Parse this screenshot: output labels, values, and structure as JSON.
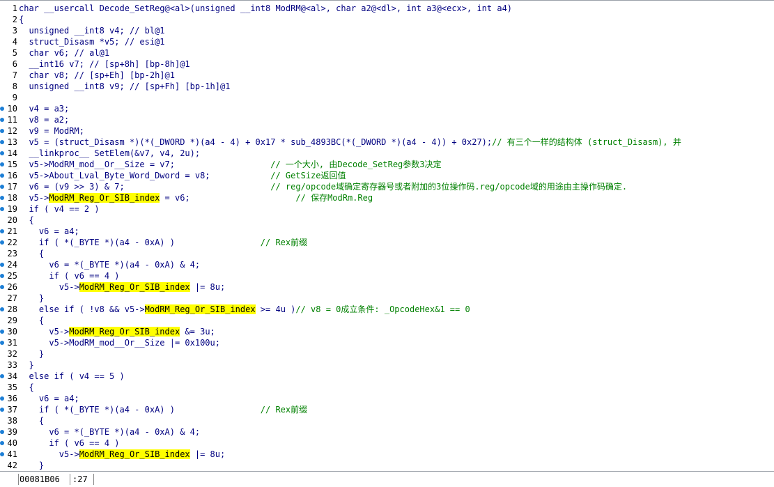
{
  "colors": {
    "default": "#000080",
    "comment": "#008000",
    "highlight_bg": "#ffff00",
    "breakpoint": "#1d7fd6"
  },
  "lines": [
    {
      "n": "1",
      "bp": false,
      "segs": [
        [
          "char __usercall Decode_SetReg@<al>(unsigned __int8 ModRM@<al>, char a2@<dl>, int a3@<ecx>, int a4)",
          "p"
        ]
      ]
    },
    {
      "n": "2",
      "bp": false,
      "segs": [
        [
          "{",
          "p"
        ]
      ]
    },
    {
      "n": "3",
      "bp": false,
      "segs": [
        [
          "  unsigned __int8 v4; ",
          "p"
        ],
        [
          "// bl@1",
          "v"
        ]
      ]
    },
    {
      "n": "4",
      "bp": false,
      "segs": [
        [
          "  struct_Disasm *v5; ",
          "p"
        ],
        [
          "// esi@1",
          "v"
        ]
      ]
    },
    {
      "n": "5",
      "bp": false,
      "segs": [
        [
          "  char v6; ",
          "p"
        ],
        [
          "// al@1",
          "v"
        ]
      ]
    },
    {
      "n": "6",
      "bp": false,
      "segs": [
        [
          "  __int16 v7; ",
          "p"
        ],
        [
          "// [sp+8h] [bp-8h]@1",
          "v"
        ]
      ]
    },
    {
      "n": "7",
      "bp": false,
      "segs": [
        [
          "  char v8; ",
          "p"
        ],
        [
          "// [sp+Eh] [bp-2h]@1",
          "v"
        ]
      ]
    },
    {
      "n": "8",
      "bp": false,
      "segs": [
        [
          "  unsigned __int8 v9; ",
          "p"
        ],
        [
          "// [sp+Fh] [bp-1h]@1",
          "v"
        ]
      ]
    },
    {
      "n": "9",
      "bp": false,
      "segs": []
    },
    {
      "n": "10",
      "bp": true,
      "segs": [
        [
          "  v4 = a3;",
          "p"
        ]
      ]
    },
    {
      "n": "11",
      "bp": true,
      "segs": [
        [
          "  v8 = a2;",
          "p"
        ]
      ]
    },
    {
      "n": "12",
      "bp": true,
      "segs": [
        [
          "  v9 = ModRM;",
          "p"
        ]
      ]
    },
    {
      "n": "13",
      "bp": true,
      "segs": [
        [
          "  v5 = (struct_Disasm *)(*(_DWORD *)(a4 - 4) + 0x17 * sub_4893BC(*(_DWORD *)(a4 - 4)) + 0x27);",
          "p"
        ],
        [
          "// 有三个一样的结构体 (struct_Disasm), 并",
          "c"
        ]
      ]
    },
    {
      "n": "14",
      "bp": true,
      "segs": [
        [
          "  __linkproc__ SetElem(&v7, v4, 2u);",
          "p"
        ]
      ]
    },
    {
      "n": "15",
      "bp": true,
      "segs": [
        [
          "  v5->ModRM_mod__Or__Size = v7;",
          "p"
        ],
        [
          "                   // 一个大小, 由Decode_SetReg参数3决定",
          "c"
        ]
      ]
    },
    {
      "n": "16",
      "bp": true,
      "segs": [
        [
          "  v5->About_Lval_Byte_Word_Dword = v8;",
          "p"
        ],
        [
          "            // GetSize返回值",
          "c"
        ]
      ]
    },
    {
      "n": "17",
      "bp": true,
      "segs": [
        [
          "  v6 = (v9 >> 3) & 7;",
          "p"
        ],
        [
          "                             // reg/opcode域确定寄存器号或者附加的3位操作码.reg/opcode域的用途由主操作码确定.",
          "c"
        ]
      ]
    },
    {
      "n": "18",
      "bp": true,
      "segs": [
        [
          "  v5->",
          "p"
        ],
        [
          "ModRM_Reg_Or_SIB_index",
          "h"
        ],
        [
          " = v6;",
          "p"
        ],
        [
          "                     // 保存ModRm.Reg",
          "c"
        ]
      ]
    },
    {
      "n": "19",
      "bp": true,
      "segs": [
        [
          "  if ( v4 == 2 )",
          "p"
        ]
      ]
    },
    {
      "n": "20",
      "bp": false,
      "segs": [
        [
          "  {",
          "p"
        ]
      ]
    },
    {
      "n": "21",
      "bp": true,
      "segs": [
        [
          "    v6 = a4;",
          "p"
        ]
      ]
    },
    {
      "n": "22",
      "bp": true,
      "segs": [
        [
          "    if ( *(_BYTE *)(a4 - 0xA) )",
          "p"
        ],
        [
          "                 // Rex前缀",
          "c"
        ]
      ]
    },
    {
      "n": "23",
      "bp": false,
      "segs": [
        [
          "    {",
          "p"
        ]
      ]
    },
    {
      "n": "24",
      "bp": true,
      "segs": [
        [
          "      v6 = *(_BYTE *)(a4 - 0xA) & 4;",
          "p"
        ]
      ]
    },
    {
      "n": "25",
      "bp": true,
      "segs": [
        [
          "      if ( v6 == 4 )",
          "p"
        ]
      ]
    },
    {
      "n": "26",
      "bp": true,
      "segs": [
        [
          "        v5->",
          "p"
        ],
        [
          "ModRM_Reg_Or_SIB_index",
          "h"
        ],
        [
          " |= 8u;",
          "p"
        ]
      ]
    },
    {
      "n": "27",
      "bp": false,
      "segs": [
        [
          "    }",
          "p"
        ]
      ]
    },
    {
      "n": "28",
      "bp": true,
      "segs": [
        [
          "    else if ( !v8 && v5->",
          "p"
        ],
        [
          "ModRM_Reg_Or_SIB_index",
          "h"
        ],
        [
          " >= 4u )",
          "p"
        ],
        [
          "// v8 = 0成立条件: _OpcodeHex&1 == 0",
          "c"
        ]
      ]
    },
    {
      "n": "29",
      "bp": false,
      "segs": [
        [
          "    {",
          "p"
        ]
      ]
    },
    {
      "n": "30",
      "bp": true,
      "segs": [
        [
          "      v5->",
          "p"
        ],
        [
          "ModRM_Reg_Or_SIB_index",
          "h"
        ],
        [
          " &= 3u;",
          "p"
        ]
      ]
    },
    {
      "n": "31",
      "bp": true,
      "segs": [
        [
          "      v5->ModRM_mod__Or__Size |= 0x100u;",
          "p"
        ]
      ]
    },
    {
      "n": "32",
      "bp": false,
      "segs": [
        [
          "    }",
          "p"
        ]
      ]
    },
    {
      "n": "33",
      "bp": false,
      "segs": [
        [
          "  }",
          "p"
        ]
      ]
    },
    {
      "n": "34",
      "bp": true,
      "segs": [
        [
          "  else if ( v4 == 5 )",
          "p"
        ]
      ]
    },
    {
      "n": "35",
      "bp": false,
      "segs": [
        [
          "  {",
          "p"
        ]
      ]
    },
    {
      "n": "36",
      "bp": true,
      "segs": [
        [
          "    v6 = a4;",
          "p"
        ]
      ]
    },
    {
      "n": "37",
      "bp": true,
      "segs": [
        [
          "    if ( *(_BYTE *)(a4 - 0xA) )",
          "p"
        ],
        [
          "                 // Rex前缀",
          "c"
        ]
      ]
    },
    {
      "n": "38",
      "bp": false,
      "segs": [
        [
          "    {",
          "p"
        ]
      ]
    },
    {
      "n": "39",
      "bp": true,
      "segs": [
        [
          "      v6 = *(_BYTE *)(a4 - 0xA) & 4;",
          "p"
        ]
      ]
    },
    {
      "n": "40",
      "bp": true,
      "segs": [
        [
          "      if ( v6 == 4 )",
          "p"
        ]
      ]
    },
    {
      "n": "41",
      "bp": true,
      "segs": [
        [
          "        v5->",
          "p"
        ],
        [
          "ModRM_Reg_Or_SIB_index",
          "h"
        ],
        [
          " |= 8u;",
          "p"
        ]
      ]
    },
    {
      "n": "42",
      "bp": false,
      "segs": [
        [
          "    }",
          "p"
        ]
      ]
    }
  ],
  "status": {
    "address": "00081B06",
    "position": ":27"
  }
}
